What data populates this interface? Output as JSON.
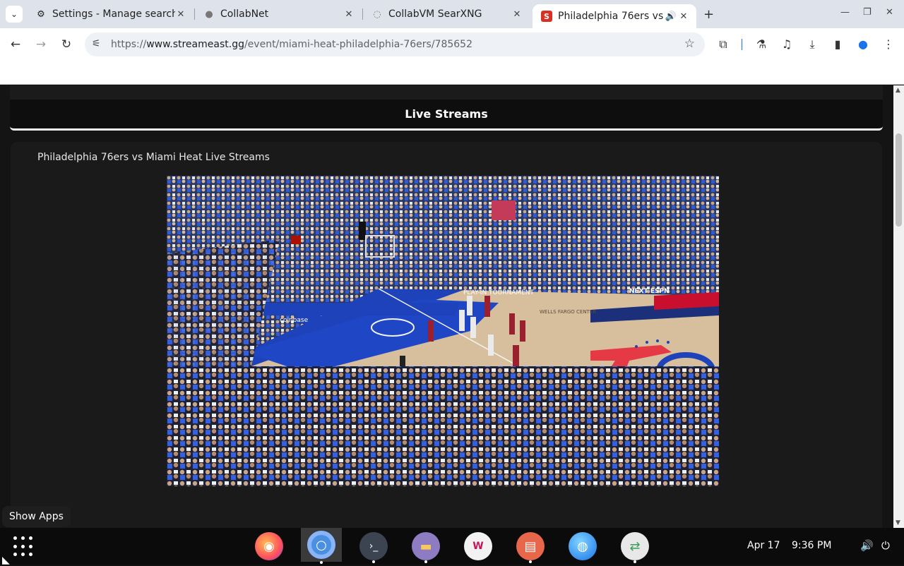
{
  "browser": {
    "tabs": [
      {
        "title": "Settings - Manage search engines",
        "favicon": "gear-icon"
      },
      {
        "title": "CollabNet",
        "favicon": "globe-icon"
      },
      {
        "title": "CollabVM SearXNG",
        "favicon": "searxng-icon"
      },
      {
        "title": "Philadelphia 76ers vs Miami Heat",
        "favicon": "streameast-icon",
        "active": true
      }
    ],
    "url_prefix": "https://",
    "url_host": "www.streameast.gg",
    "url_path": "/event/miami-heat-philadelphia-76ers/785652"
  },
  "page": {
    "section_header": "Live Streams",
    "card_title": "Philadelphia 76ers vs Miami Heat Live Streams",
    "video": {
      "court_signs": [
        "coinbase",
        "PLAY-IN TOURNAMENT",
        "NEXT ESPN",
        "WELLS FARGO CENTER"
      ],
      "court_logo": "76"
    }
  },
  "taskbar": {
    "tooltip": "Show Apps",
    "date": "Apr 17",
    "time": "9:36 PM"
  },
  "colors": {
    "tab_strip": "#dee3eb",
    "page_bg": "#141414",
    "sixers_blue": "#1d42ba",
    "sixers_red": "#ed174c"
  }
}
